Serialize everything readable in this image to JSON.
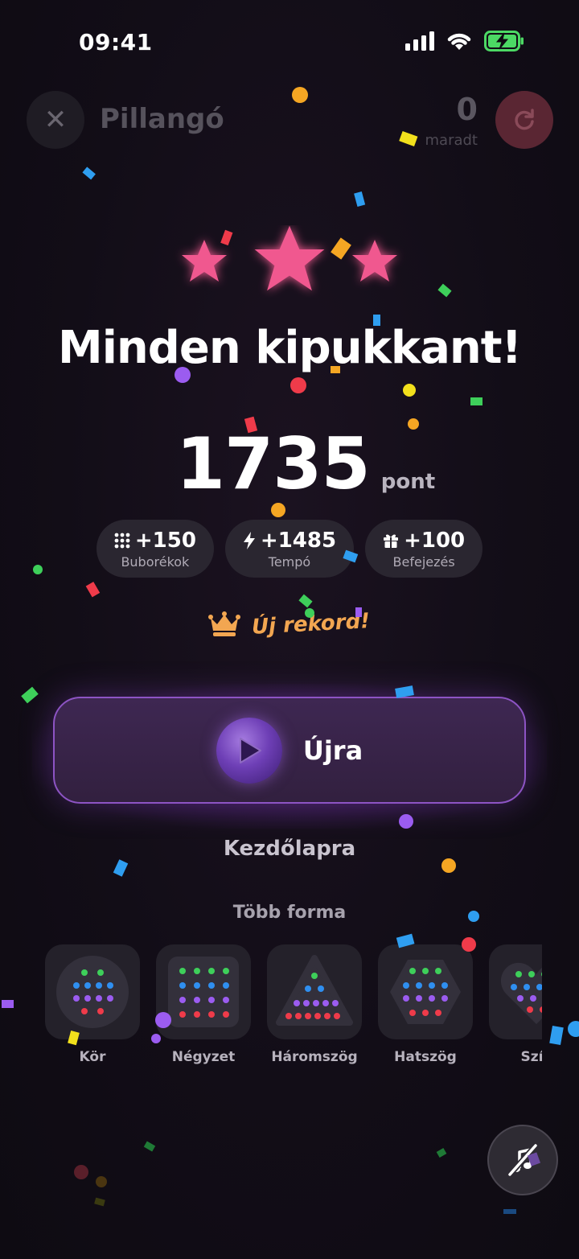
{
  "status_bar": {
    "time": "09:41"
  },
  "header": {
    "title": "Pillangó",
    "remaining_count": "0",
    "remaining_label": "maradt"
  },
  "result": {
    "stars_earned": 3,
    "headline": "Minden kipukkant!",
    "score": "1735",
    "score_unit": "pont"
  },
  "bonuses": [
    {
      "icon": "grid-icon",
      "value": "+150",
      "label": "Buborékok"
    },
    {
      "icon": "lightning-icon",
      "value": "+1485",
      "label": "Tempó"
    },
    {
      "icon": "gift-icon",
      "value": "+100",
      "label": "Befejezés"
    }
  ],
  "record": {
    "icon": "crown-icon",
    "text": "Új rekord!"
  },
  "actions": {
    "replay_label": "Újra",
    "home_label": "Kezdőlapra"
  },
  "more_shapes": {
    "title": "Több forma",
    "items": [
      {
        "label": "Kör"
      },
      {
        "label": "Négyzet"
      },
      {
        "label": "Háromszög"
      },
      {
        "label": "Hatszög"
      },
      {
        "label": "Szív"
      }
    ]
  },
  "colors": {
    "star": "#f0588f",
    "accent_purple": "#8d54c4",
    "record_orange": "#f2a651",
    "restart_red": "#5a2633"
  }
}
